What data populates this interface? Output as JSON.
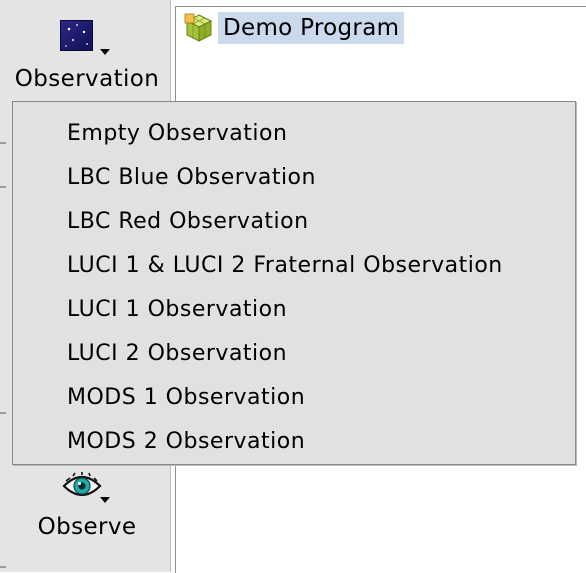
{
  "sidebar": {
    "observation_button": {
      "label": "Observation",
      "icon": "observation-sky-icon"
    },
    "observe_button": {
      "label": "Observe",
      "icon": "eye-icon"
    }
  },
  "tree": {
    "root": {
      "label": "Demo Program",
      "icon": "program-cube-icon",
      "selected": true
    }
  },
  "menu": {
    "items": [
      {
        "label": "Empty Observation"
      },
      {
        "label": "LBC Blue Observation"
      },
      {
        "label": "LBC Red Observation"
      },
      {
        "label": "LUCI 1 & LUCI 2 Fraternal Observation"
      },
      {
        "label": "LUCI 1 Observation"
      },
      {
        "label": "LUCI 2 Observation"
      },
      {
        "label": "MODS 1 Observation"
      },
      {
        "label": "MODS 2 Observation"
      }
    ]
  },
  "colors": {
    "selection": "#cad9ec",
    "menu_bg": "#e1e1e1",
    "sidebar_bg": "#e4e4e4",
    "icon_sky": "#1e1a6e",
    "icon_cube": "#b8d448",
    "icon_eye": "#24a8a8"
  }
}
